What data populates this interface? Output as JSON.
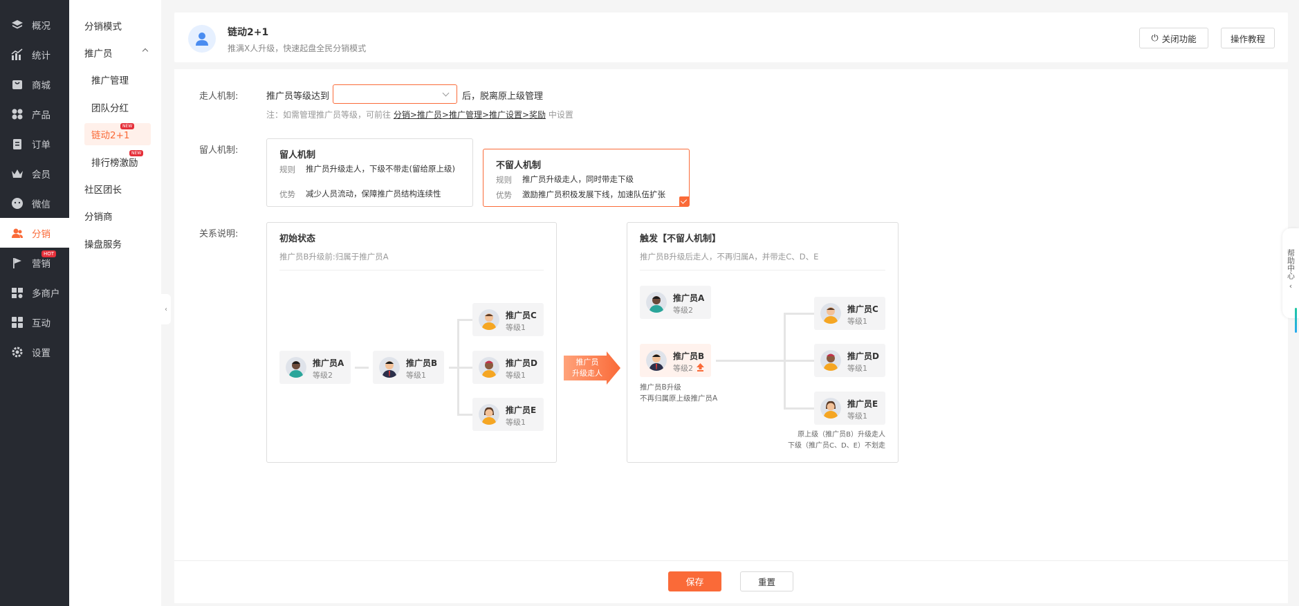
{
  "nav": {
    "items": [
      {
        "label": "概况",
        "icon": "layers-icon"
      },
      {
        "label": "统计",
        "icon": "chart-icon"
      },
      {
        "label": "商城",
        "icon": "shop-icon"
      },
      {
        "label": "产品",
        "icon": "grid-icon"
      },
      {
        "label": "订单",
        "icon": "clipboard-icon"
      },
      {
        "label": "会员",
        "icon": "crown-icon"
      },
      {
        "label": "微信",
        "icon": "wechat-icon"
      },
      {
        "label": "分销",
        "icon": "users-icon"
      },
      {
        "label": "营销",
        "icon": "flag-icon",
        "badge": "HOT"
      },
      {
        "label": "多商户",
        "icon": "store-icon"
      },
      {
        "label": "互动",
        "icon": "puzzle-icon"
      },
      {
        "label": "设置",
        "icon": "gear-icon"
      }
    ],
    "active_index": 7
  },
  "subnav": {
    "items": [
      {
        "label": "分销模式"
      },
      {
        "label": "推广员"
      },
      {
        "label": "推广管理"
      },
      {
        "label": "团队分红"
      },
      {
        "label": "链动2+1",
        "badge": "NEW"
      },
      {
        "label": "排行榜激励",
        "badge": "NEW"
      },
      {
        "label": "社区团长"
      },
      {
        "label": "分销商"
      },
      {
        "label": "操盘服务"
      }
    ]
  },
  "header": {
    "title": "链动2+1",
    "desc": "推满X人升级，快速起盘全民分销模式",
    "close_btn": "关闭功能",
    "tutorial_btn": "操作教程"
  },
  "form": {
    "leave_label": "走人机制:",
    "leave_prefix": "推广员等级达到",
    "leave_suffix": "后，脱离原上级管理",
    "select_value": "",
    "note_prefix": "注：如需管理推广员等级，可前往 ",
    "note_link": "分销>推广员>推广管理>推广设置>奖励",
    "note_suffix": " 中设置",
    "stay_label": "留人机制:",
    "relation_label": "关系说明:"
  },
  "stay_card": {
    "title": "留人机制",
    "rule_k": "规则",
    "rule_v": "推广员升级走人，下级不带走(留给原上级)",
    "adv_k": "优势",
    "adv_v": "减少人员流动，保障推广员结构连续性"
  },
  "nostay_card": {
    "title": "不留人机制",
    "rule_k": "规则",
    "rule_v": "推广员升级走人，同时带走下级",
    "adv_k": "优势",
    "adv_v": "激励推广员积极发展下线，加速队伍扩张",
    "selected": true
  },
  "initial": {
    "title": "初始状态",
    "sub": "推广员B升级前:归属于推广员A",
    "nodes": [
      {
        "name": "推广员A",
        "level": "等级2"
      },
      {
        "name": "推广员B",
        "level": "等级1"
      },
      {
        "name": "推广员C",
        "level": "等级1"
      },
      {
        "name": "推广员D",
        "level": "等级1"
      },
      {
        "name": "推广员E",
        "level": "等级1"
      }
    ]
  },
  "arrow": {
    "line1": "推广员",
    "line2": "升级走人"
  },
  "trigger": {
    "title": "触发【不留人机制】",
    "sub": "推广员B升级后走人，不再归属A，并带走C、D、E",
    "nodes": [
      {
        "name": "推广员A",
        "level": "等级2"
      },
      {
        "name": "推广员B",
        "level": "等级2"
      },
      {
        "name": "推广员C",
        "level": "等级1"
      },
      {
        "name": "推广员D",
        "level": "等级1"
      },
      {
        "name": "推广员E",
        "level": "等级1"
      }
    ],
    "caption_b1": "推广员B升级",
    "caption_b2": "不再归属原上级推广员A",
    "caption_r1": "原上级（推广员B）升级走人",
    "caption_r2": "下级（推广员C、D、E）不划走"
  },
  "footer": {
    "save": "保存",
    "reset": "重置"
  },
  "help": {
    "label": "帮助中心"
  },
  "colors": {
    "accent": "#fa6a38",
    "nav_bg": "#272a31"
  }
}
